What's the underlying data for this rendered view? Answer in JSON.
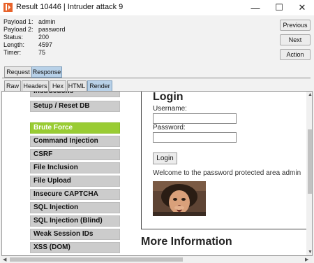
{
  "window": {
    "title": "Result 10446 | Intruder attack 9",
    "controls": {
      "minimize": "—",
      "maximize": "☐",
      "close": "✕"
    }
  },
  "info": {
    "rows": [
      {
        "key": "Payload 1:",
        "value": "admin"
      },
      {
        "key": "Payload 2:",
        "value": "password"
      },
      {
        "key": "Status:",
        "value": "200"
      },
      {
        "key": "Length:",
        "value": "4597"
      },
      {
        "key": "Timer:",
        "value": "75"
      }
    ],
    "buttons": {
      "previous": "Previous",
      "next": "Next",
      "action": "Action"
    }
  },
  "main_tabs": [
    {
      "label": "Request",
      "active": false
    },
    {
      "label": "Response",
      "active": true
    }
  ],
  "sub_tabs": [
    {
      "label": "Raw",
      "active": false
    },
    {
      "label": "Headers",
      "active": false
    },
    {
      "label": "Hex",
      "active": false
    },
    {
      "label": "HTML",
      "active": false
    },
    {
      "label": "Render",
      "active": true
    }
  ],
  "render": {
    "menu": [
      {
        "label": "Instructions",
        "active": false
      },
      {
        "label": "Setup / Reset DB",
        "active": false
      },
      {
        "label": "Brute Force",
        "active": true
      },
      {
        "label": "Command Injection",
        "active": false
      },
      {
        "label": "CSRF",
        "active": false
      },
      {
        "label": "File Inclusion",
        "active": false
      },
      {
        "label": "File Upload",
        "active": false
      },
      {
        "label": "Insecure CAPTCHA",
        "active": false
      },
      {
        "label": "SQL Injection",
        "active": false
      },
      {
        "label": "SQL Injection (Blind)",
        "active": false
      },
      {
        "label": "Weak Session IDs",
        "active": false
      },
      {
        "label": "XSS (DOM)",
        "active": false
      }
    ],
    "login": {
      "title": "Login",
      "username_label": "Username:",
      "username_value": "",
      "password_label": "Password:",
      "password_value": "",
      "button": "Login",
      "welcome": "Welcome to the password protected area admin"
    },
    "more_info": "More Information"
  },
  "colors": {
    "menu_active": "#99cc33",
    "menu_default": "#cccccc",
    "tab_active": "#b8d1e8",
    "app_icon": "#e8632b"
  }
}
